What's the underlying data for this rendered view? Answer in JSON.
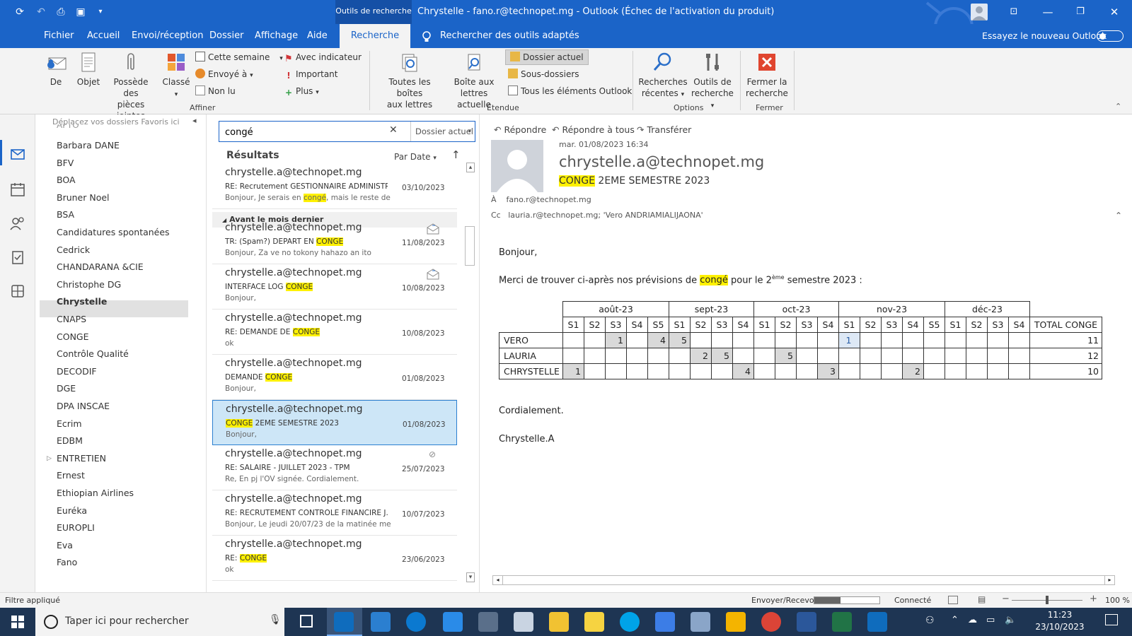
{
  "titlebar": {
    "context_tab": "Outils de recherche",
    "title": "Chrystelle  -  fano.r@technopet.mg  -  Outlook (Échec de l'activation du produit)"
  },
  "menu": {
    "items": [
      "Fichier",
      "Accueil",
      "Envoi/réception",
      "Dossier",
      "Affichage",
      "Aide"
    ],
    "active": "Recherche",
    "tips": "Rechercher des outils adaptés",
    "try_new": "Essayez le nouveau Outlook"
  },
  "ribbon": {
    "refine": {
      "de": "De",
      "objet": "Objet",
      "pieces": [
        "Possède des",
        "pièces jointes"
      ],
      "classe": "Classé",
      "cette_semaine": "Cette semaine",
      "envoye": "Envoyé à",
      "non_lu": "Non lu",
      "avec_indicateur": "Avec indicateur",
      "important": "Important",
      "plus": "Plus",
      "group": "Affiner"
    },
    "scope": {
      "toutes": [
        "Toutes les boîtes",
        "aux lettres"
      ],
      "boite": [
        "Boîte aux",
        "lettres actuelle"
      ],
      "dossier_actuel": "Dossier actuel",
      "sous_dossiers": "Sous-dossiers",
      "tous": "Tous les éléments Outlook",
      "group": "Étendue"
    },
    "options": {
      "recentes": [
        "Recherches",
        "récentes"
      ],
      "outils": [
        "Outils de",
        "recherche"
      ],
      "group": "Options"
    },
    "close": {
      "label": [
        "Fermer la",
        "recherche"
      ],
      "group": "Fermer"
    }
  },
  "folders": {
    "favorites_hint": "Déplacez vos dossiers Favoris ici",
    "items": [
      "Barbara DANE",
      "BFV",
      "BOA",
      "Bruner Noel",
      "BSA",
      "Candidatures spontanées",
      "Cedrick",
      "CHANDARANA &CIE",
      "Christophe DG",
      "Chrystelle",
      "CNAPS",
      "CONGE",
      "Contrôle Qualité",
      "DECODIF",
      "DGE",
      "DPA INSCAE",
      "Ecrim",
      "EDBM",
      "ENTRETIEN",
      "Ernest",
      "Ethiopian Airlines",
      "Euréka",
      "EUROPLI",
      "Eva",
      "Fano"
    ],
    "selected": "Chrystelle"
  },
  "search": {
    "value": "congé",
    "scope": "Dossier actuel"
  },
  "list": {
    "title": "Résultats",
    "sort": "Par Date",
    "group_header": "Avant le mois dernier",
    "mails": [
      {
        "from": "chrystelle.a@technopet.mg",
        "subj_pre": "RE: Recrutement GESTIONNAIRE ADMINISTR...",
        "subj_hl": "",
        "subj_post": "",
        "prev_pre": "Bonjour,  Je serais en ",
        "prev_hl": "congé",
        "prev_post": ", mais le reste de",
        "date": "03/10/2023"
      },
      {
        "from": "chrystelle.a@technopet.mg",
        "subj_pre": "TR: (Spam?) DEPART EN ",
        "subj_hl": "CONGE",
        "subj_post": "",
        "prev_pre": "Bonjour,  Za ve no tokony hahazo an ito",
        "prev_hl": "",
        "prev_post": "",
        "date": "11/08/2023"
      },
      {
        "from": "chrystelle.a@technopet.mg",
        "subj_pre": "INTERFACE LOG ",
        "subj_hl": "CONGE",
        "subj_post": "",
        "prev_pre": "Bonjour,",
        "prev_hl": "",
        "prev_post": "",
        "date": "10/08/2023"
      },
      {
        "from": "chrystelle.a@technopet.mg",
        "subj_pre": "RE: DEMANDE DE ",
        "subj_hl": "CONGE",
        "subj_post": "",
        "prev_pre": "ok",
        "prev_hl": "",
        "prev_post": "",
        "date": "10/08/2023"
      },
      {
        "from": "chrystelle.a@technopet.mg",
        "subj_pre": "DEMANDE ",
        "subj_hl": "CONGE",
        "subj_post": "",
        "prev_pre": "Bonjour,",
        "prev_hl": "",
        "prev_post": "",
        "date": "01/08/2023"
      },
      {
        "from": "chrystelle.a@technopet.mg",
        "subj_pre": "",
        "subj_hl": "CONGE",
        "subj_post": " 2EME SEMESTRE 2023",
        "prev_pre": "Bonjour,",
        "prev_hl": "",
        "prev_post": "",
        "date": "01/08/2023"
      },
      {
        "from": "chrystelle.a@technopet.mg",
        "subj_pre": "RE: SALAIRE - JUILLET 2023 - TPM",
        "subj_hl": "",
        "subj_post": "",
        "prev_pre": "Re,  En pj l'OV signée.  Cordialement.",
        "prev_hl": "",
        "prev_post": "",
        "date": "25/07/2023"
      },
      {
        "from": "chrystelle.a@technopet.mg",
        "subj_pre": "RE: RECRUTEMENT CONTROLE FINANCIRE J...",
        "subj_hl": "",
        "subj_post": "",
        "prev_pre": "Bonjour,  Le jeudi 20/07/23 de la matinée me",
        "prev_hl": "",
        "prev_post": "",
        "date": "10/07/2023"
      },
      {
        "from": "chrystelle.a@technopet.mg",
        "subj_pre": "RE: ",
        "subj_hl": "CONGE",
        "subj_post": "",
        "prev_pre": "ok",
        "prev_hl": "",
        "prev_post": "",
        "date": "23/06/2023"
      }
    ]
  },
  "reading": {
    "actions": {
      "reply": "Répondre",
      "reply_all": "Répondre à tous",
      "forward": "Transférer"
    },
    "date": "mar. 01/08/2023 16:34",
    "sender": "chrystelle.a@technopet.mg",
    "subject_hl": "CONGE",
    "subject_rest": " 2EME SEMESTRE 2023",
    "to_label": "À",
    "to": "fano.r@technopet.mg",
    "cc_label": "Cc",
    "cc": "lauria.r@technopet.mg; 'Vero ANDRIAMIALIJAONA'",
    "greeting": "Bonjour,",
    "intro_pre": "Merci de trouver ci-après nos prévisions de ",
    "intro_hl": "congé",
    "intro_mid": " pour le 2",
    "intro_sup": "ème",
    "intro_post": " semestre 2023 :",
    "closing": "Cordialement.",
    "signature": "Chrystelle.A"
  },
  "table": {
    "months": [
      {
        "label": "août-23",
        "weeks": [
          "S1",
          "S2",
          "S3",
          "S4",
          "S5"
        ]
      },
      {
        "label": "sept-23",
        "weeks": [
          "S1",
          "S2",
          "S3",
          "S4"
        ]
      },
      {
        "label": "oct-23",
        "weeks": [
          "S1",
          "S2",
          "S3",
          "S4"
        ]
      },
      {
        "label": "nov-23",
        "weeks": [
          "S1",
          "S2",
          "S3",
          "S4",
          "S5"
        ]
      },
      {
        "label": "déc-23",
        "weeks": [
          "S1",
          "S2",
          "S3",
          "S4"
        ]
      }
    ],
    "total_label": "TOTAL CONGE",
    "rows": [
      {
        "name": "VERO",
        "cells": [
          "",
          "",
          "1",
          "",
          "4",
          "5",
          "",
          "",
          "",
          "",
          "",
          "",
          "",
          "1",
          "",
          "",
          "",
          "",
          "",
          "",
          "",
          ""
        ],
        "total": "11"
      },
      {
        "name": "LAURIA",
        "cells": [
          "",
          "",
          "",
          "",
          "",
          "",
          "2",
          "5",
          "",
          "",
          "5",
          "",
          "",
          "",
          "",
          "",
          "",
          "",
          "",
          "",
          "",
          ""
        ],
        "total": "12"
      },
      {
        "name": "CHRYSTELLE",
        "cells": [
          "1",
          "",
          "",
          "",
          "",
          "",
          "",
          "",
          "4",
          "",
          "",
          "",
          "3",
          "",
          "",
          "",
          "2",
          "",
          "",
          "",
          "",
          ""
        ],
        "total": "10"
      }
    ]
  },
  "status": {
    "filter": "Filtre appliqué",
    "sendrecv": "Envoyer/Recevoir",
    "connected": "Connecté",
    "zoom": "100 %"
  },
  "taskbar": {
    "search_placeholder": "Taper ici pour rechercher",
    "time": "11:23",
    "date": "23/10/2023"
  }
}
